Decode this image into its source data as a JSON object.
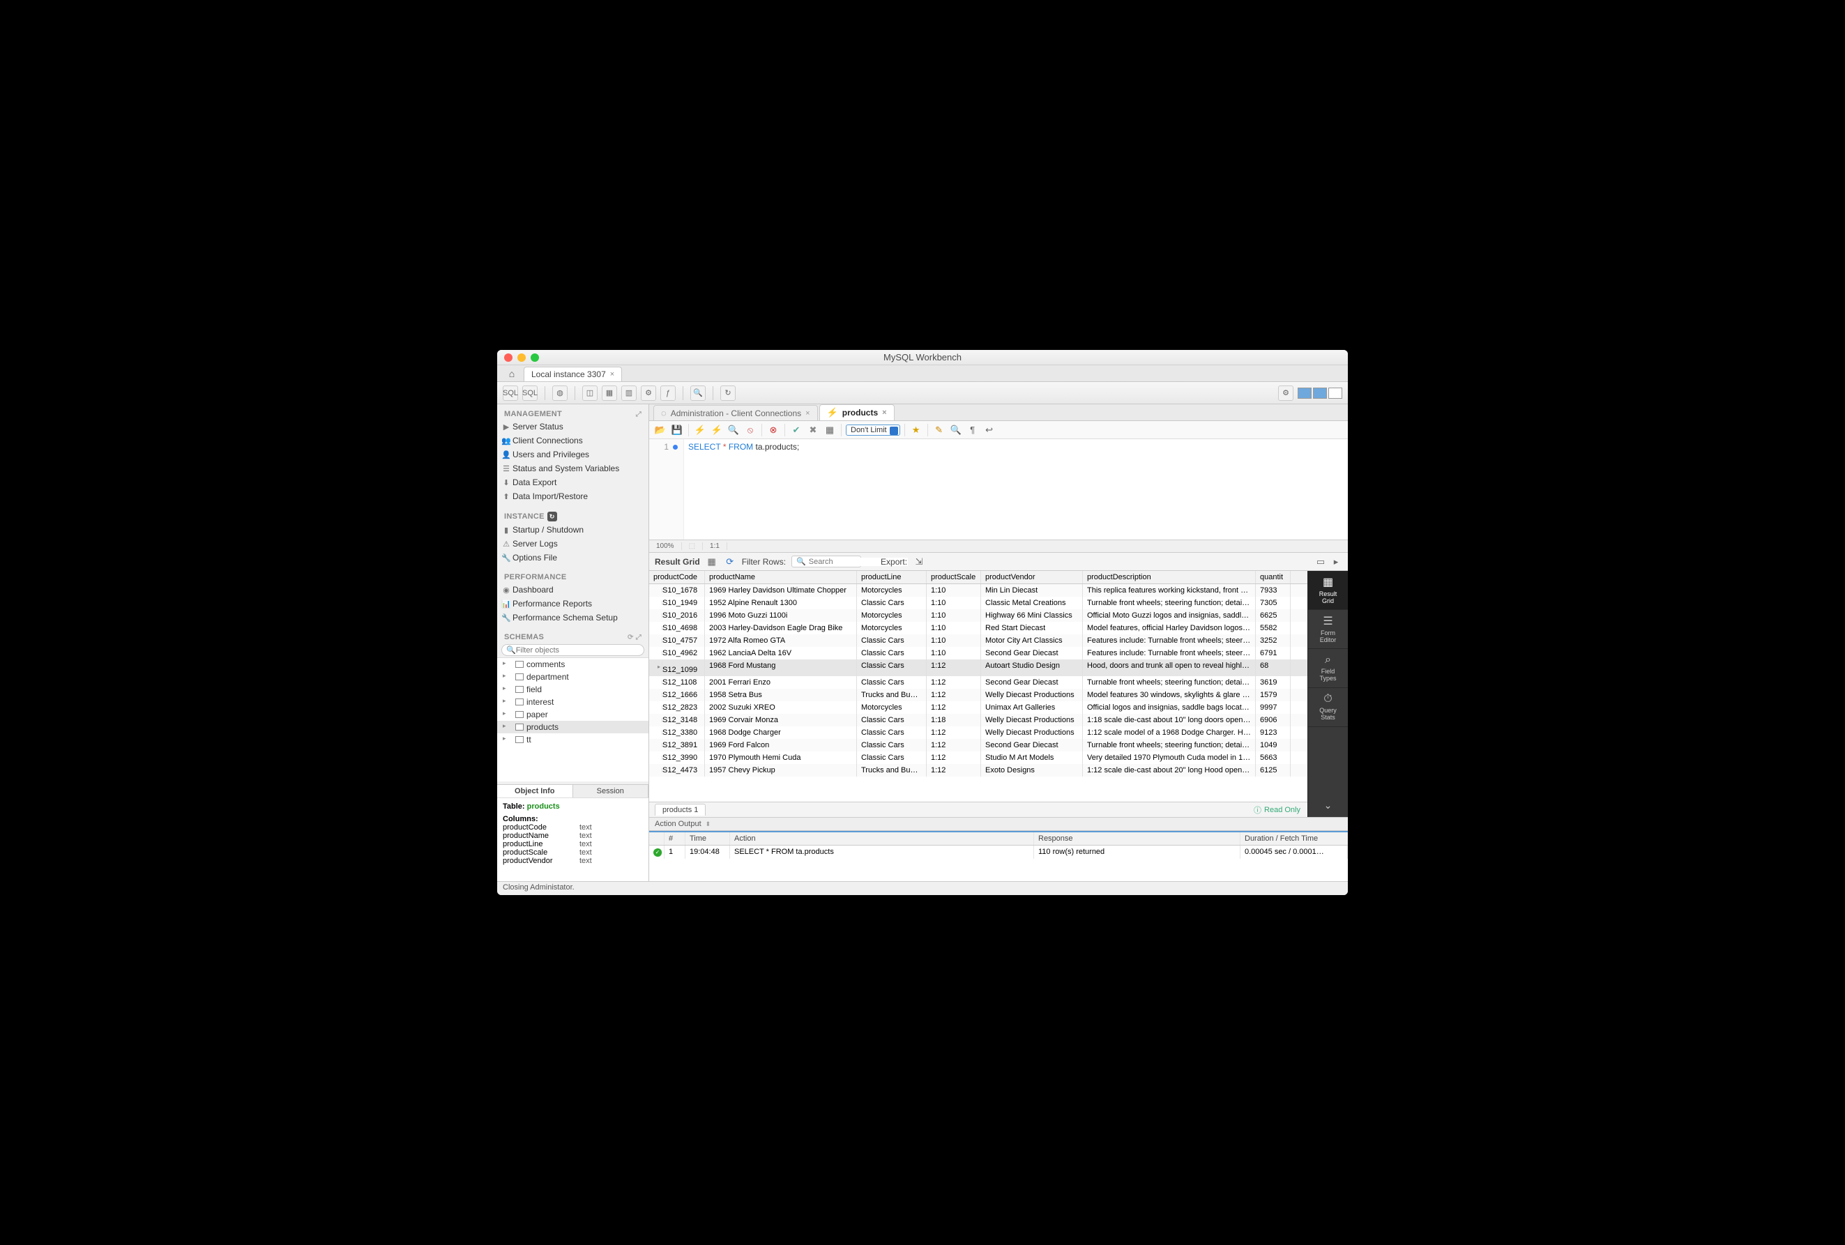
{
  "window": {
    "title": "MySQL Workbench"
  },
  "conn_tab": {
    "label": "Local instance 3307"
  },
  "sidebar": {
    "sections": {
      "management": {
        "title": "MANAGEMENT",
        "items": [
          "Server Status",
          "Client Connections",
          "Users and Privileges",
          "Status and System Variables",
          "Data Export",
          "Data Import/Restore"
        ]
      },
      "instance": {
        "title": "INSTANCE",
        "items": [
          "Startup / Shutdown",
          "Server Logs",
          "Options File"
        ]
      },
      "performance": {
        "title": "PERFORMANCE",
        "items": [
          "Dashboard",
          "Performance Reports",
          "Performance Schema Setup"
        ]
      },
      "schemas": {
        "title": "SCHEMAS",
        "filter_placeholder": "Filter objects",
        "items": [
          "comments",
          "department",
          "field",
          "interest",
          "paper",
          "products",
          "tt"
        ]
      }
    },
    "obj_tabs": [
      "Object Info",
      "Session"
    ],
    "obj_info": {
      "table_label": "Table:",
      "table_name": "products",
      "columns_label": "Columns:",
      "columns": [
        {
          "name": "productCode",
          "type": "text"
        },
        {
          "name": "productName",
          "type": "text"
        },
        {
          "name": "productLine",
          "type": "text"
        },
        {
          "name": "productScale",
          "type": "text"
        },
        {
          "name": "productVendor",
          "type": "text"
        }
      ]
    }
  },
  "query_tabs": [
    {
      "label": "Administration - Client Connections",
      "active": false
    },
    {
      "label": "products",
      "active": true
    }
  ],
  "query_toolbar": {
    "limit": "Don't Limit"
  },
  "editor": {
    "line_no": "1",
    "sql": {
      "kw1": "SELECT",
      "op": "*",
      "kw2": "FROM",
      "ident": "ta.products;"
    },
    "zoom": "100%",
    "pos": "1:1"
  },
  "result_bar": {
    "label": "Result Grid",
    "filter_label": "Filter Rows:",
    "search_placeholder": "Search",
    "export_label": "Export:"
  },
  "columns": [
    "productCode",
    "productName",
    "productLine",
    "productScale",
    "productVendor",
    "productDescription",
    "quantit"
  ],
  "rows": [
    [
      "S10_1678",
      "1969 Harley Davidson Ultimate Chopper",
      "Motorcycles",
      "1:10",
      "Min Lin Diecast",
      "This replica features working kickstand, front su…",
      "7933"
    ],
    [
      "S10_1949",
      "1952 Alpine Renault 1300",
      "Classic Cars",
      "1:10",
      "Classic Metal Creations",
      "Turnable front wheels; steering function; detaile…",
      "7305"
    ],
    [
      "S10_2016",
      "1996 Moto Guzzi 1100i",
      "Motorcycles",
      "1:10",
      "Highway 66 Mini Classics",
      "Official Moto Guzzi logos and insignias, saddle…",
      "6625"
    ],
    [
      "S10_4698",
      "2003 Harley-Davidson Eagle Drag Bike",
      "Motorcycles",
      "1:10",
      "Red Start Diecast",
      "Model features, official Harley Davidson logos a…",
      "5582"
    ],
    [
      "S10_4757",
      "1972 Alfa Romeo GTA",
      "Classic Cars",
      "1:10",
      "Motor City Art Classics",
      "Features include: Turnable front wheels; steerin…",
      "3252"
    ],
    [
      "S10_4962",
      "1962 LanciaA Delta 16V",
      "Classic Cars",
      "1:10",
      "Second Gear Diecast",
      "Features include: Turnable front wheels; steerin…",
      "6791"
    ],
    [
      "S12_1099",
      "1968 Ford Mustang",
      "Classic Cars",
      "1:12",
      "Autoart Studio Design",
      "Hood, doors and trunk all open to reveal highly…",
      "68"
    ],
    [
      "S12_1108",
      "2001 Ferrari Enzo",
      "Classic Cars",
      "1:12",
      "Second Gear Diecast",
      "Turnable front wheels; steering function; detaile…",
      "3619"
    ],
    [
      "S12_1666",
      "1958 Setra Bus",
      "Trucks and Buses",
      "1:12",
      "Welly Diecast Productions",
      "Model features 30 windows, skylights & glare re…",
      "1579"
    ],
    [
      "S12_2823",
      "2002 Suzuki XREO",
      "Motorcycles",
      "1:12",
      "Unimax Art Galleries",
      "Official logos and insignias, saddle bags located…",
      "9997"
    ],
    [
      "S12_3148",
      "1969 Corvair Monza",
      "Classic Cars",
      "1:18",
      "Welly Diecast Productions",
      "1:18 scale die-cast about 10\" long doors open,…",
      "6906"
    ],
    [
      "S12_3380",
      "1968 Dodge Charger",
      "Classic Cars",
      "1:12",
      "Welly Diecast Productions",
      "1:12 scale model of a 1968 Dodge Charger. Ho…",
      "9123"
    ],
    [
      "S12_3891",
      "1969 Ford Falcon",
      "Classic Cars",
      "1:12",
      "Second Gear Diecast",
      "Turnable front wheels; steering function; detaile…",
      "1049"
    ],
    [
      "S12_3990",
      "1970 Plymouth Hemi Cuda",
      "Classic Cars",
      "1:12",
      "Studio M Art Models",
      "Very detailed 1970 Plymouth Cuda model in 1:1…",
      "5663"
    ],
    [
      "S12_4473",
      "1957 Chevy Pickup",
      "Trucks and Buses",
      "1:12",
      "Exoto Designs",
      "1:12 scale die-cast about 20\" long Hood opens,…",
      "6125"
    ]
  ],
  "selected_row_index": 6,
  "grid_tab": "products 1",
  "readonly": "Read Only",
  "right_panel": [
    {
      "label": "Result\nGrid",
      "icon": "▦"
    },
    {
      "label": "Form\nEditor",
      "icon": "☰"
    },
    {
      "label": "Field\nTypes",
      "icon": "⌕"
    },
    {
      "label": "Query\nStats",
      "icon": "⏱"
    }
  ],
  "action_output": {
    "title": "Action Output",
    "headers": [
      "",
      "#",
      "Time",
      "Action",
      "Response",
      "Duration / Fetch Time"
    ],
    "row": {
      "idx": "1",
      "time": "19:04:48",
      "action": "SELECT * FROM ta.products",
      "resp": "110 row(s) returned",
      "dur": "0.00045 sec / 0.0001…"
    }
  },
  "status": "Closing Administator."
}
